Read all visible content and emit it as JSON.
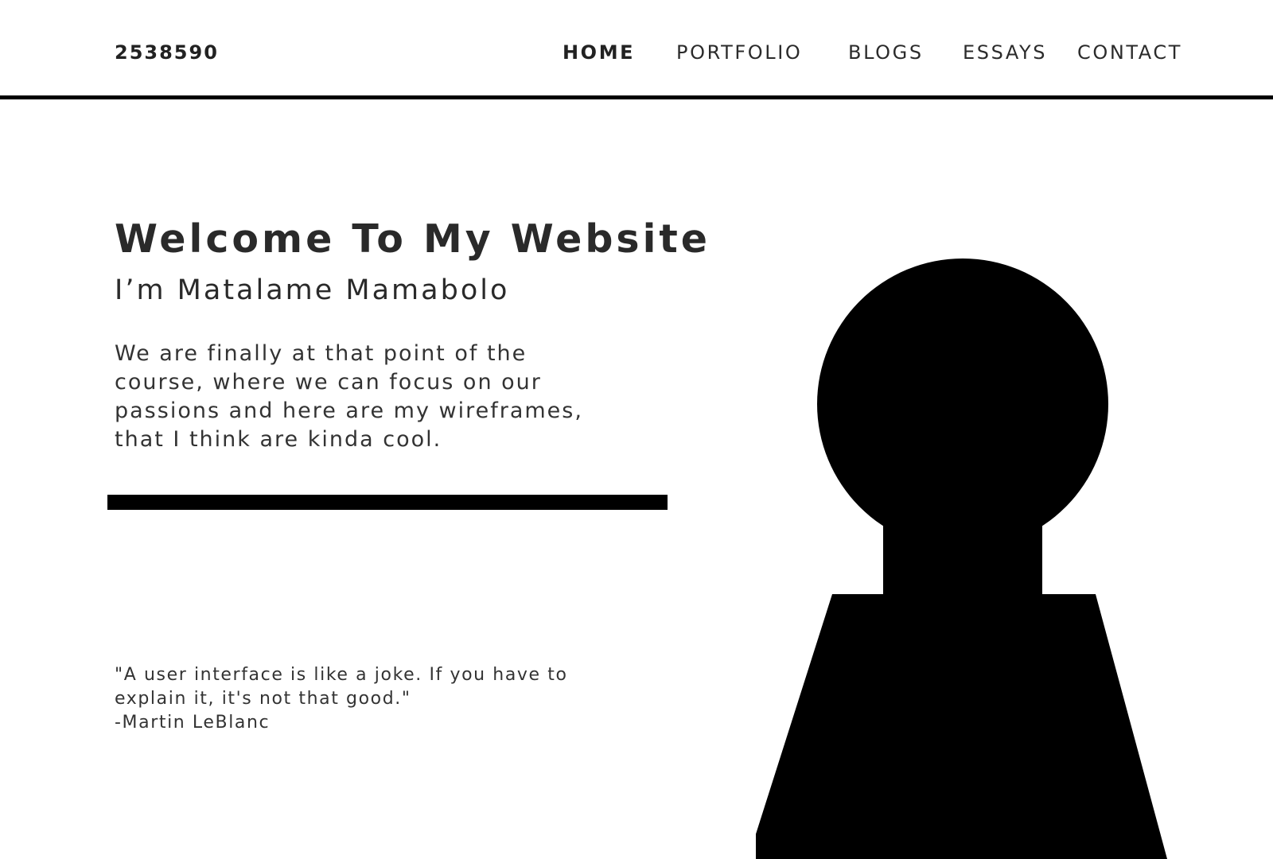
{
  "header": {
    "brand": "2538590",
    "nav": [
      {
        "label": "HOME",
        "active": true
      },
      {
        "label": "PORTFOLIO",
        "active": false
      },
      {
        "label": "BLOGS",
        "active": false
      },
      {
        "label": "ESSAYS",
        "active": false
      },
      {
        "label": "CONTACT",
        "active": false
      }
    ]
  },
  "hero": {
    "title": "Welcome To My Website",
    "subtitle": "I’m Matalame Mamabolo",
    "intro": "We are finally at that point of the course, where we can focus on our passions and here are my wireframes, that I think are kinda cool."
  },
  "quote": {
    "text": "\"A user interface is like a joke. If you have to explain it, it's not that good.\"",
    "author": "-Martin LeBlanc"
  },
  "image": {
    "icon": "person-silhouette-icon",
    "color": "#000000"
  }
}
